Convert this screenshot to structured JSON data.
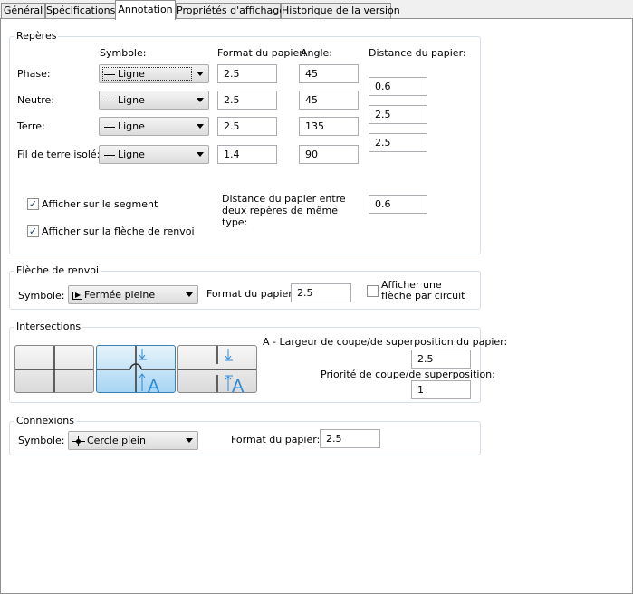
{
  "tabs": [
    "Général",
    "Spécifications",
    "Annotation",
    "Propriétés d'affichage",
    "Historique de la version"
  ],
  "reperes": {
    "title": "Repères",
    "col_symbole": "Symbole:",
    "col_format": "Format du papier:",
    "col_angle": "Angle:",
    "col_distance": "Distance du papier:",
    "rows": [
      {
        "label": "Phase:",
        "symbol": "Ligne",
        "format": "2.5",
        "angle": "45"
      },
      {
        "label": "Neutre:",
        "symbol": "Ligne",
        "format": "2.5",
        "angle": "45"
      },
      {
        "label": "Terre:",
        "symbol": "Ligne",
        "format": "2.5",
        "angle": "135"
      },
      {
        "label": "Fil de terre isolé:",
        "symbol": "Ligne",
        "format": "1.4",
        "angle": "90"
      }
    ],
    "distances": [
      "0.6",
      "2.5",
      "2.5"
    ],
    "show_segment": "Afficher sur le segment",
    "show_segment_checked": true,
    "show_arrow": "Afficher sur la flèche de renvoi",
    "show_arrow_checked": true,
    "same_type_distance_label": "Distance du papier entre deux repères de même type:",
    "same_type_distance_value": "0.6"
  },
  "fleche": {
    "title": "Flèche de renvoi",
    "symbole_label": "Symbole:",
    "symbole_value": "Fermée pleine",
    "format_label": "Format du papier:",
    "format_value": "2.5",
    "circuit_label": "Afficher une flèche par circuit",
    "circuit_checked": false
  },
  "intersections": {
    "title": "Intersections",
    "selected_index": 1,
    "width_label": "A - Largeur de coupe/de superposition du papier:",
    "width_value": "2.5",
    "priority_label": "Priorité de coupe/de superposition:",
    "priority_value": "1",
    "glyph_letter": "A"
  },
  "connexions": {
    "title": "Connexions",
    "symbole_label": "Symbole:",
    "symbole_value": "Cercle plein",
    "format_label": "Format du papier:",
    "format_value": "2.5"
  }
}
